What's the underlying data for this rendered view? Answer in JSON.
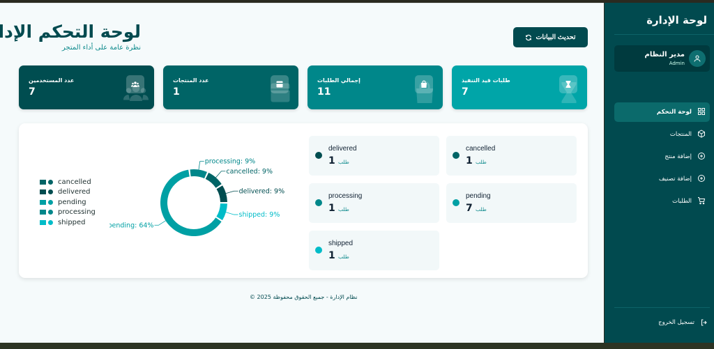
{
  "sidebar": {
    "title": "لوحة الإدارة",
    "user_name": "مدير النظام",
    "user_role": "Admin",
    "items": [
      {
        "label": "لوحة التحكم",
        "icon": "grid-icon",
        "active": true
      },
      {
        "label": "المنتجات",
        "icon": "box-icon"
      },
      {
        "label": "إضافة منتج",
        "icon": "plus-circle-icon"
      },
      {
        "label": "إضافة تصنيف",
        "icon": "plus-circle-icon"
      },
      {
        "label": "الطلبات",
        "icon": "cart-icon"
      }
    ],
    "logout": "تسجيل الخروج"
  },
  "header": {
    "title": "لوحة التحكم الإدارية",
    "subtitle": "نظرة عامة على أداء المتجر",
    "refresh_label": "تحديث البيانات"
  },
  "stats": [
    {
      "label": "طلبات قيد التنفيذ",
      "value": "7",
      "icon": "hourglass-icon",
      "color": "#00a5a8"
    },
    {
      "label": "إجمالي الطلبات",
      "value": "11",
      "icon": "shopping-bag-icon",
      "color": "#00878a"
    },
    {
      "label": "عدد المنتجات",
      "value": "1",
      "icon": "box-icon",
      "color": "#006466"
    },
    {
      "label": "عدد المستخدمين",
      "value": "7",
      "icon": "users-icon",
      "color": "#004d50"
    }
  ],
  "chart_data": {
    "type": "pie",
    "donut": true,
    "legend_position": "left",
    "categories": [
      "processing",
      "cancelled",
      "delivered",
      "shipped",
      "pending"
    ],
    "values": [
      1,
      1,
      1,
      1,
      7
    ],
    "labels": [
      "processing: 9%",
      "cancelled: 9%",
      "delivered: 9%",
      "shipped: 9%",
      "pending: 64%"
    ],
    "colors": [
      "#00878a",
      "#006466",
      "#004d50",
      "#00bcc8",
      "#00a0a4"
    ],
    "legend": [
      {
        "name": "cancelled",
        "color": "#006466"
      },
      {
        "name": "delivered",
        "color": "#004d50"
      },
      {
        "name": "pending",
        "color": "#00a0a4"
      },
      {
        "name": "processing",
        "color": "#00878a"
      },
      {
        "name": "shipped",
        "color": "#00bcc8"
      }
    ]
  },
  "status_cards": [
    {
      "name": "cancelled",
      "count": "1",
      "unit": "طلب",
      "color": "#006466"
    },
    {
      "name": "delivered",
      "count": "1",
      "unit": "طلب",
      "color": "#004d50"
    },
    {
      "name": "pending",
      "count": "7",
      "unit": "طلب",
      "color": "#00a0a4"
    },
    {
      "name": "processing",
      "count": "1",
      "unit": "طلب",
      "color": "#00878a"
    },
    {
      "name": "shipped",
      "count": "1",
      "unit": "طلب",
      "color": "#00bcc8"
    }
  ],
  "footer": "نظام الإدارة - جميع الحقوق محفوظة 2025 ©"
}
